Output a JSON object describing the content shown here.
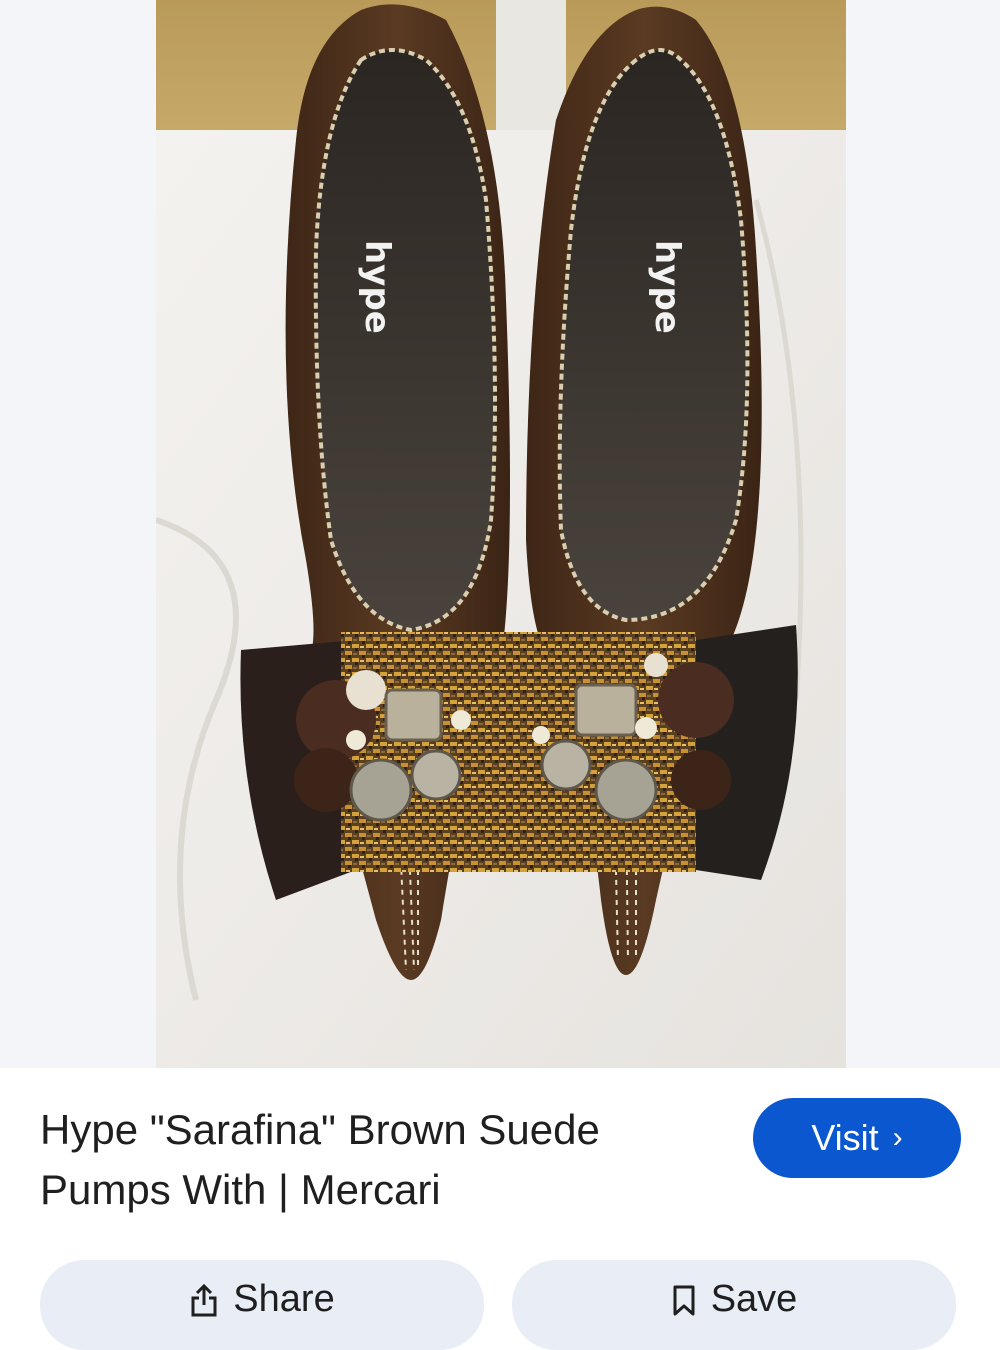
{
  "product": {
    "title": "Hype \"Sarafina\" Brown Suede Pumps With | Mercari",
    "brand_insole_text": "hype"
  },
  "buttons": {
    "visit_label": "Visit",
    "visit_chevron": "›",
    "share_label": "Share",
    "save_label": "Save"
  },
  "icons": {
    "share": "share-icon",
    "save": "bookmark-icon",
    "visit_chevron": "chevron-right-icon"
  },
  "colors": {
    "accent": "#0b57d0",
    "action_button_bg": "#e9eef6",
    "text": "#1f1f1f"
  }
}
